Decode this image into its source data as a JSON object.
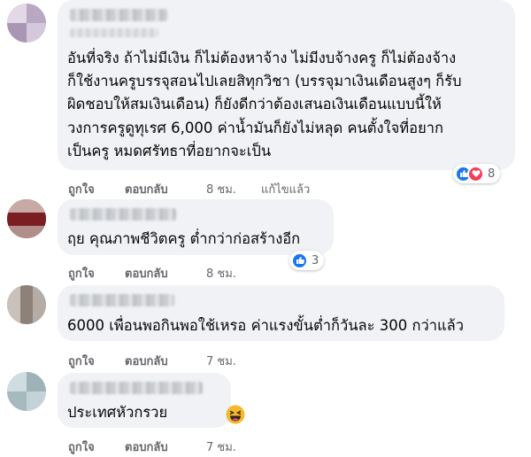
{
  "comments": [
    {
      "text_lines": [
        "อันที่จริง ถ้าไม่มีเงิน ก็ไม่ต้องหาจ้าง ไม่มีงบจ้างครู ก็ไม่ต้องจ้าง",
        "ก็ใช้งานครูบรรจุสอนไปเลยสิทุกวิชา (บรรจุมาเงินเดือนสูงๆ ก็รับ",
        "ผิดชอบให้สมเงินเดือน) ก็ยังดีกว่าต้องเสนอเงินเดือนแบบนี้ให้",
        "วงการครูดูทุเรศ 6,000 ค่าน้ำมันก็ยังไม่หลุด คนตั้งใจที่อยาก",
        "เป็นครู หมดศรัทธาที่อยากจะเป็น"
      ],
      "like_label": "ถูกใจ",
      "reply_label": "ตอบกลับ",
      "time": "8 ชม.",
      "edited_label": "แก้ไขแล้ว",
      "reaction_count": "8",
      "reactions": [
        "like-icon",
        "love-icon"
      ]
    },
    {
      "text_lines": [
        "ฤย คุณภาพชีวิตครู ต่ำกว่าก่อสร้างอีก"
      ],
      "like_label": "ถูกใจ",
      "reply_label": "ตอบกลับ",
      "time": "8 ชม.",
      "reaction_count": "3",
      "reactions": [
        "like-icon"
      ]
    },
    {
      "text_lines": [
        "6000 เพื่อนพอกินพอใช้เหรอ ค่าแรงขั้นต่ำก็วันละ 300 กว่าแล้ว"
      ],
      "like_label": "ถูกใจ",
      "reply_label": "ตอบกลับ",
      "time": "7 ชม."
    },
    {
      "text_lines": [
        "ประเทศหัวกรวย"
      ],
      "like_label": "ถูกใจ",
      "reply_label": "ตอบกลับ",
      "time": "7 ชม.",
      "reactions": [
        "laughing-emoji-icon"
      ]
    }
  ],
  "colors": {
    "bubble": "#f0f2f5",
    "action_text": "#65676b",
    "like_blue": "#1877f2",
    "love_red": "#f33e58"
  }
}
